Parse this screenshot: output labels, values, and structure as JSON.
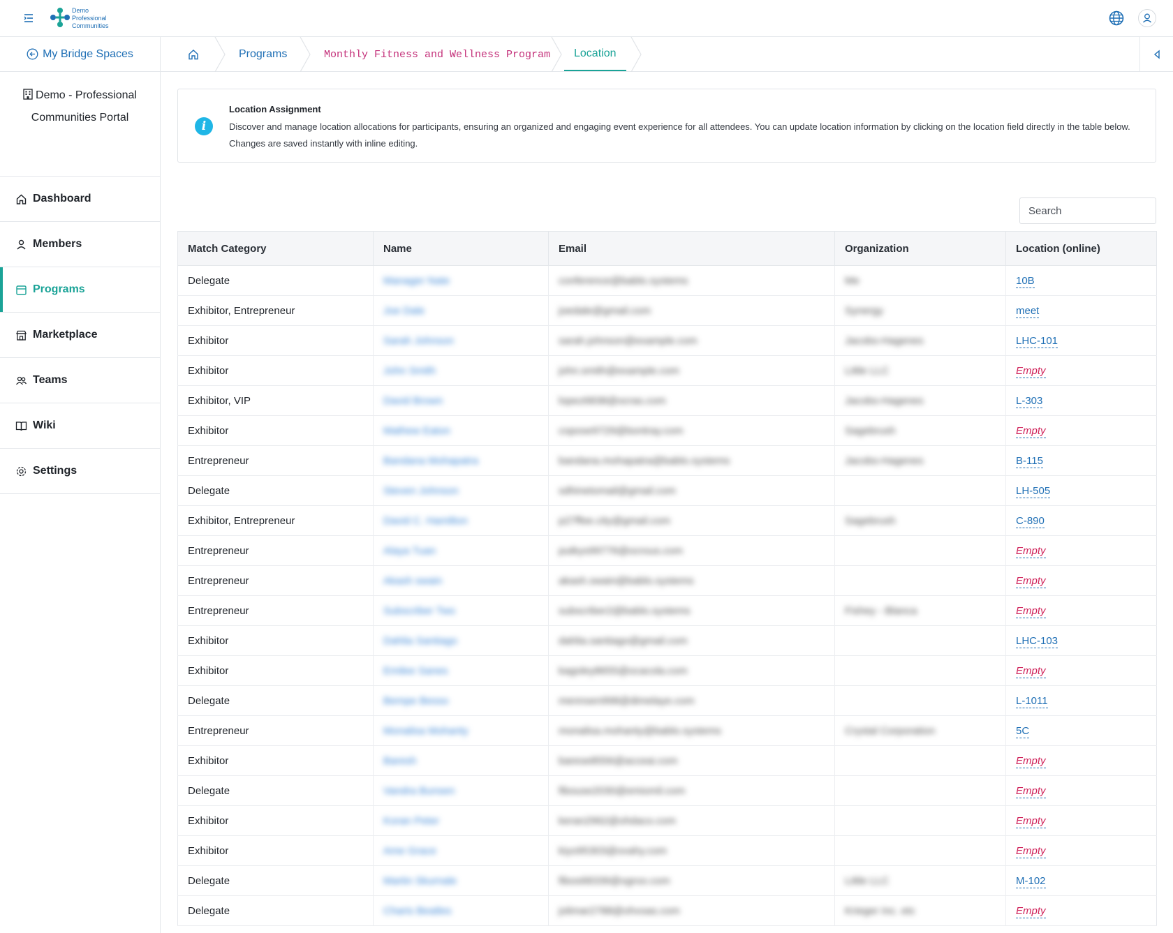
{
  "app": {
    "logo_lines": [
      "Demo",
      "Professional",
      "Communities"
    ]
  },
  "sidebar": {
    "back_label": "My Bridge Spaces",
    "portal_line1": "Demo - Professional",
    "portal_line2": "Communities Portal",
    "items": [
      {
        "label": "Dashboard",
        "icon": "home-icon"
      },
      {
        "label": "Members",
        "icon": "user-icon"
      },
      {
        "label": "Programs",
        "icon": "calendar-icon",
        "active": true
      },
      {
        "label": "Marketplace",
        "icon": "store-icon"
      },
      {
        "label": "Teams",
        "icon": "team-icon"
      },
      {
        "label": "Wiki",
        "icon": "book-icon"
      },
      {
        "label": "Settings",
        "icon": "gear-icon"
      }
    ]
  },
  "breadcrumb": {
    "programs": "Programs",
    "program": "Monthly Fitness and Wellness Program",
    "current": "Location"
  },
  "info": {
    "title": "Location Assignment",
    "body": "Discover and manage location allocations for participants, ensuring an organized and engaging event experience for all attendees. You can update location information by clicking on the location field directly in the table below. Changes are saved instantly with inline editing."
  },
  "search": {
    "placeholder": "Search"
  },
  "table": {
    "headers": [
      "Match Category",
      "Name",
      "Email",
      "Organization",
      "Location (online)"
    ],
    "rows": [
      {
        "category": "Delegate",
        "name": "Manager Nate",
        "email": "conference@bablo.systems",
        "org": "Me",
        "location": "10B",
        "empty": false
      },
      {
        "category": "Exhibitor, Entrepreneur",
        "name": "Joe Dale",
        "email": "joedale@gmail.com",
        "org": "Synergy",
        "location": "meet",
        "empty": false
      },
      {
        "category": "Exhibitor",
        "name": "Sarah Johnson",
        "email": "sarah.johnson@example.com",
        "org": "Jacobs-Hagenes",
        "location": "LHC-101",
        "empty": false
      },
      {
        "category": "Exhibitor",
        "name": "John Smith",
        "email": "john.smith@example.com",
        "org": "Little LLC",
        "location": "Empty",
        "empty": true
      },
      {
        "category": "Exhibitor, VIP",
        "name": "David Brown",
        "email": "lopez6838@ocras.com",
        "org": "Jacobs-Hagenes",
        "location": "L-303",
        "empty": false
      },
      {
        "category": "Exhibitor",
        "name": "Mathew Eaton",
        "email": "copose9729@bontray.com",
        "org": "Sagebrush",
        "location": "Empty",
        "empty": true
      },
      {
        "category": "Entrepreneur",
        "name": "Bandana Mohapatra",
        "email": "bandana.mohapatra@bablo.systems",
        "org": "Jacobs-Hagenes",
        "location": "B-115",
        "empty": false
      },
      {
        "category": "Delegate",
        "name": "Steven Johnson",
        "email": "sdhinetomail@gmail.com",
        "org": "",
        "location": "LH-505",
        "empty": false
      },
      {
        "category": "Exhibitor, Entrepreneur",
        "name": "David C. Hamilton",
        "email": "p27ffee.city@gmail.com",
        "org": "Sagebrush",
        "location": "C-890",
        "empty": false
      },
      {
        "category": "Entrepreneur",
        "name": "Alaya Tuan",
        "email": "putkys99776@ocrous.com",
        "org": "",
        "location": "Empty",
        "empty": true
      },
      {
        "category": "Entrepreneur",
        "name": "Akash swain",
        "email": "akash.swain@bablo.systems",
        "org": "",
        "location": "Empty",
        "empty": true
      },
      {
        "category": "Entrepreneur",
        "name": "Subscriber Two",
        "email": "subscriber2@bablo.systems",
        "org": "Fishey - Blanca",
        "location": "Empty",
        "empty": true
      },
      {
        "category": "Exhibitor",
        "name": "Dahlia Santiago",
        "email": "dahlia.santiago@gmail.com",
        "org": "",
        "location": "LHC-103",
        "empty": false
      },
      {
        "category": "Exhibitor",
        "name": "Emilee Sanes",
        "email": "kagoley8655@ocacola.com",
        "org": "",
        "location": "Empty",
        "empty": true
      },
      {
        "category": "Delegate",
        "name": "Bempe Besso",
        "email": "mennsen998@dimelaye.com",
        "org": "",
        "location": "L-1011",
        "empty": false
      },
      {
        "category": "Entrepreneur",
        "name": "Monalisa Mohanty",
        "email": "monalisa.mohanty@bablo.systems",
        "org": "Crystal Corporation",
        "location": "5C",
        "empty": false
      },
      {
        "category": "Exhibitor",
        "name": "Baresh",
        "email": "barese8556@acceai.com",
        "org": "",
        "location": "Empty",
        "empty": true
      },
      {
        "category": "Delegate",
        "name": "Vandra Bunsen",
        "email": "fibouse2030@emiomil.com",
        "org": "",
        "location": "Empty",
        "empty": true
      },
      {
        "category": "Exhibitor",
        "name": "Koran Peter",
        "email": "keran2962@ohdaco.com",
        "org": "",
        "location": "Empty",
        "empty": true
      },
      {
        "category": "Exhibitor",
        "name": "Ame Grace",
        "email": "kiyo95303@ovahy.com",
        "org": "",
        "location": "Empty",
        "empty": true
      },
      {
        "category": "Delegate",
        "name": "Martin Skurnale",
        "email": "fibos68339@ogroo.com",
        "org": "Little LLC",
        "location": "M-102",
        "empty": false
      },
      {
        "category": "Delegate",
        "name": "Charis Beatles",
        "email": "jolimar2788@ohvoas.com",
        "org": "Krieger Inc. etc",
        "location": "Empty",
        "empty": true
      }
    ]
  },
  "colors": {
    "accent": "#1aa397",
    "link": "#1f6fb5",
    "empty": "#d0245b",
    "program_crumb": "#c4317a",
    "info_icon": "#1fb6e6"
  }
}
